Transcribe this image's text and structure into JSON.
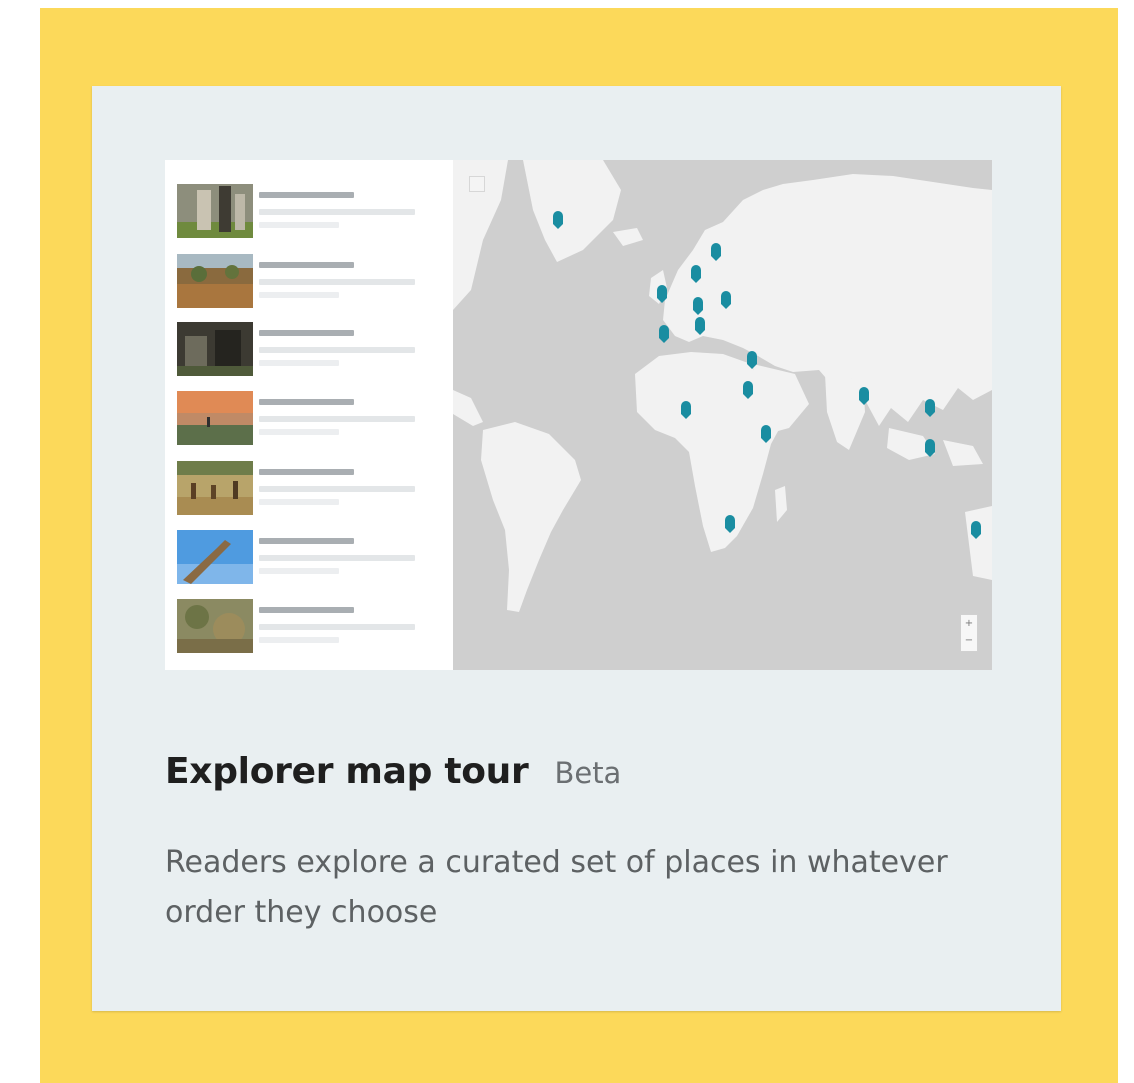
{
  "card": {
    "title": "Explorer map tour",
    "badge": "Beta",
    "description": "Readers explore a curated set of places in whatever order they choose"
  },
  "preview": {
    "list_items": [
      {
        "thumbnail": "photo-giraffes"
      },
      {
        "thumbnail": "photo-savanna"
      },
      {
        "thumbnail": "photo-gorilla"
      },
      {
        "thumbnail": "photo-sunset-plain"
      },
      {
        "thumbnail": "photo-antelopes"
      },
      {
        "thumbnail": "photo-giraffe-sky"
      },
      {
        "thumbnail": "photo-bush"
      }
    ],
    "zoom_in": "+",
    "zoom_out": "−"
  },
  "colors": {
    "frame": "#fcd95a",
    "card": "#e9eff1",
    "marker": "#1a8da1",
    "land": "#f2f2f2",
    "water": "#cfcfcf"
  }
}
